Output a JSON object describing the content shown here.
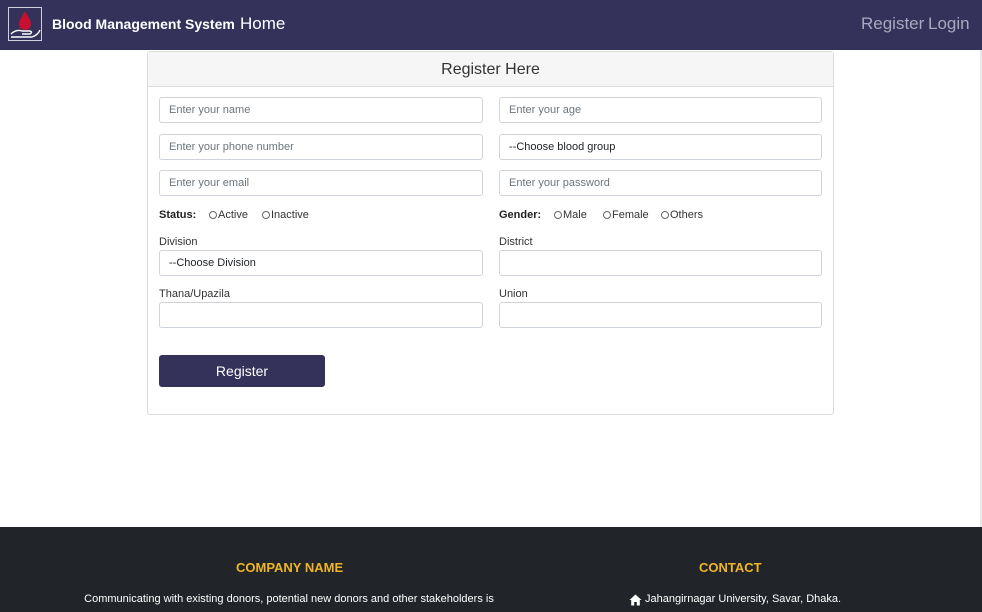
{
  "navbar": {
    "brand": "Blood Management System",
    "home": "Home",
    "register": "Register",
    "login": "Login",
    "logo_icon": "blood-drop-hand-icon"
  },
  "form": {
    "title": "Register Here",
    "name_placeholder": "Enter your name",
    "age_placeholder": "Enter your age",
    "phone_placeholder": "Enter your phone number",
    "blood_group_value": "--Choose blood group",
    "email_placeholder": "Enter your  email",
    "password_placeholder": "Enter your  password",
    "status_label": "Status:",
    "status_options": [
      "Active",
      "Inactive"
    ],
    "gender_label": "Gender:",
    "gender_options": [
      "Male",
      "Female",
      "Others"
    ],
    "division_label": "Division",
    "division_value": "--Choose Division",
    "district_label": "District",
    "district_value": "",
    "thana_label": "Thana/Upazila",
    "thana_value": "",
    "union_label": "Union",
    "union_value": "",
    "submit_label": "Register"
  },
  "footer": {
    "company_title": "COMPANY NAME",
    "company_text": "Communicating with existing donors, potential new donors and other stakeholders is",
    "contact_title": "CONTACT",
    "contact_address": "Jahangirnagar University, Savar, Dhaka.",
    "address_icon": "home-icon"
  },
  "colors": {
    "navbar_bg": "#34325a",
    "footer_bg": "#212529",
    "footer_title": "#f0b429",
    "button_bg": "#34325a"
  }
}
